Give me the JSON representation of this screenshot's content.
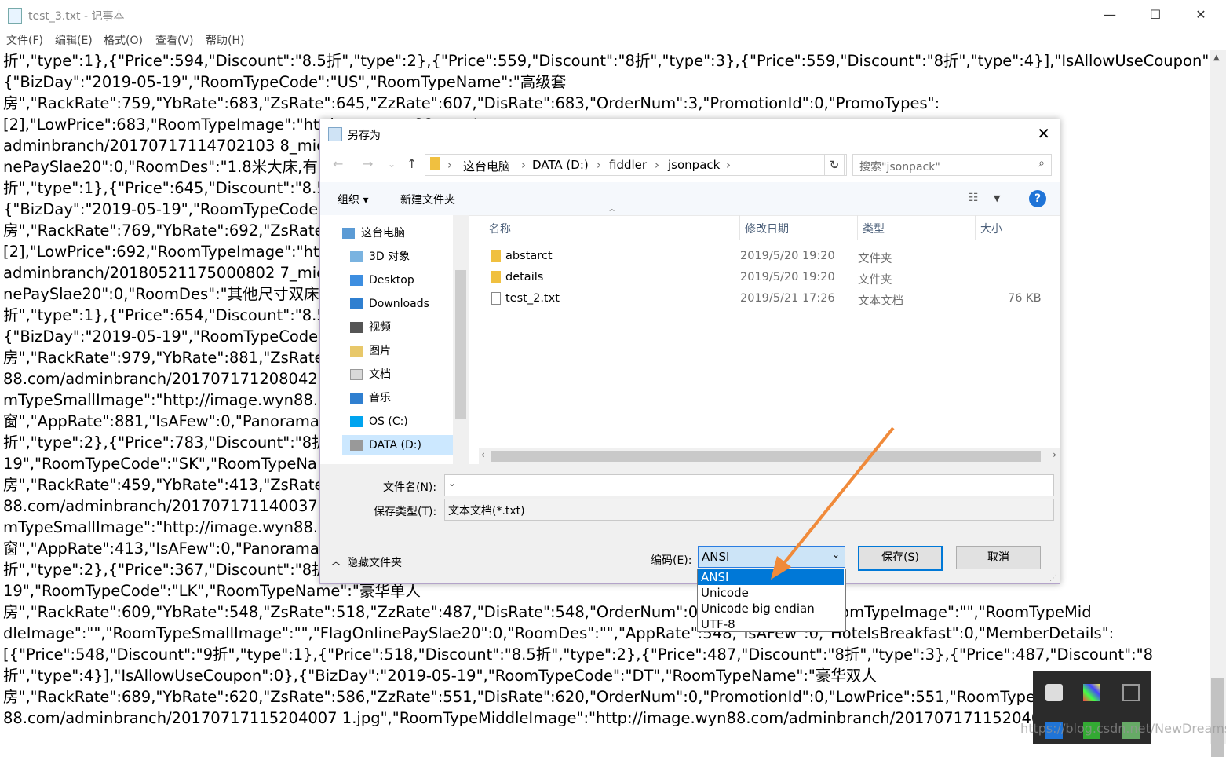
{
  "notepad": {
    "title": "test_3.txt - 记事本",
    "menu": [
      "文件(F)",
      "编辑(E)",
      "格式(O)",
      "查看(V)",
      "帮助(H)"
    ],
    "lines": [
      "折\",\"type\":1},{\"Price\":594,\"Discount\":\"8.5折\",\"type\":2},{\"Price\":559,\"Discount\":\"8折\",\"type\":3},{\"Price\":559,\"Discount\":\"8折\",\"type\":4}],\"IsAllowUseCoupon\":0},",
      "{\"BizDay\":\"2019-05-19\",\"RoomTypeCode\":\"US\",\"RoomTypeName\":\"高级套",
      "房\",\"RackRate\":759,\"YbRate\":683,\"ZsRate\":645,\"ZzRate\":607,\"DisRate\":683,\"OrderNum\":3,\"PromotionId\":0,\"PromoTypes\":",
      "[2],\"LowPrice\":683,\"RoomTypeImage\":\"htt                                                                                          image.wyn88.com/",
      "adminbranch/20170717114702103 8_midc                                                                                    mall.jpg\",\"FlagOnli",
      "nePaySlae20\":0,\"RoomDes\":\"1.8米大床,有窗                                                                              Discount\":\"9",
      "折\",\"type\":1},{\"Price\":645,\"Discount\":\"8.5折                                                                              eCoupon\":0},",
      "{\"BizDay\":\"2019-05-19\",\"RoomTypeCode\"",
      "房\",\"RackRate\":769,\"YbRate\":692,\"ZsRate\":",
      "[2],\"LowPrice\":692,\"RoomTypeImage\":\"htt                                                                                          image.wyn88.com/",
      "adminbranch/20180521175000802 7_midc                                                                                    mall.jpg\",\"FlagOnli",
      "nePaySlae20\":0,\"RoomDes\":\"其他尺寸双床,                                                                          92,\"Discount\":\"9",
      "折\",\"type\":1},{\"Price\":654,\"Discount\":\"8.5折                                                                              eCoupon\":0},",
      "{\"BizDay\":\"2019-05-19\",\"RoomTypeCode\"",
      "房\",\"RackRate\":979,\"YbRate\":881,\"ZsRate\":                                                                              \"http://image.wyn",
      "88.com/adminbranch/201707171208042                                                                                  middle.jpg\",\"Roo",
      "mTypeSmallImage\":\"http://image.wyn88.c                                                                               末,无",
      "窗\",\"AppRate\":881,\"IsAFew\":0,\"Panorama_                                                                             iscount\":\"8.5",
      "折\",\"type\":2},{\"Price\":783,\"Discount\":\"8折\",",
      "19\",\"RoomTypeCode\":\"SK\",\"RoomTypeNa",
      "房\",\"RackRate\":459,\"YbRate\":413,\"ZsRate\":                                                                              \"http://image.wyn",
      "88.com/adminbranch/201707171140037                                                                                  middle.jpg\",\"Roo",
      "mTypeSmallImage\":\"http://image.wyn88.c                                                                               末,无",
      "窗\",\"AppRate\":413,\"IsAFew\":0,\"Panorama_                                                                             iscount\":\"8.5",
      "折\",\"type\":2},{\"Price\":367,\"Discount\":\"8折\",",
      "19\",\"RoomTypeCode\":\"LK\",\"RoomTypeName\":\"豪华单人",
      "房\",\"RackRate\":609,\"YbRate\":548,\"ZsRate\":518,\"ZzRate\":487,\"DisRate\":548,\"OrderNum\":0,\"Pro                      rice\":487,\"RoomTypeImage\":\"\",\"RoomTypeMid",
      "dleImage\":\"\",\"RoomTypeSmallImage\":\"\",\"FlagOnlinePaySlae20\":0,\"RoomDes\":\"\",\"AppRate\":548,\"IsAFew\":0,\"HotelsBreakfast\":0,\"MemberDetails\":",
      "[{\"Price\":548,\"Discount\":\"9折\",\"type\":1},{\"Price\":518,\"Discount\":\"8.5折\",\"type\":2},{\"Price\":487,\"Discount\":\"8折\",\"type\":3},{\"Price\":487,\"Discount\":\"8",
      "折\",\"type\":4}],\"IsAllowUseCoupon\":0},{\"BizDay\":\"2019-05-19\",\"RoomTypeCode\":\"DT\",\"RoomTypeName\":\"豪华双人",
      "房\",\"RackRate\":689,\"YbRate\":620,\"ZsRate\":586,\"ZzRate\":551,\"DisRate\":620,\"OrderNum\":0,\"PromotionId\":0,\"LowPrice\":551,\"RoomTypeImag             ge.wyn",
      "88.com/adminbranch/20170717115204007 1.jpg\",\"RoomTypeMiddleImage\":\"http://image.wyn88.com/adminbranch/201707171152040                   \"Roo"
    ]
  },
  "dialog": {
    "title": "另存为",
    "breadcrumb": [
      "这台电脑",
      "DATA (D:)",
      "fiddler",
      "jsonpack"
    ],
    "search_placeholder": "搜索\"jsonpack\"",
    "organize": "组织 ▾",
    "new_folder": "新建文件夹",
    "nav_items": [
      "这台电脑",
      "3D 对象",
      "Desktop",
      "Downloads",
      "视频",
      "图片",
      "文档",
      "音乐",
      "OS (C:)",
      "DATA (D:)"
    ],
    "columns": [
      "名称",
      "修改日期",
      "类型",
      "大小"
    ],
    "files": [
      {
        "name": "abstarct",
        "date": "2019/5/20 19:20",
        "type": "文件夹",
        "size": ""
      },
      {
        "name": "details",
        "date": "2019/5/20 19:20",
        "type": "文件夹",
        "size": ""
      },
      {
        "name": "test_2.txt",
        "date": "2019/5/21 17:26",
        "type": "文本文档",
        "size": "76 KB"
      }
    ],
    "filename_label": "文件名(N):",
    "filename_value": "",
    "filetype_label": "保存类型(T):",
    "filetype_value": "文本文档(*.txt)",
    "hide_folders": "隐藏文件夹",
    "encoding_label": "编码(E):",
    "encoding_value": "ANSI",
    "encoding_options": [
      "ANSI",
      "Unicode",
      "Unicode big endian",
      "UTF-8"
    ],
    "save": "保存(S)",
    "cancel": "取消"
  },
  "watermark": "https://blog.csdn.net/NewDreamstyle",
  "colors": {
    "accent": "#0078d7",
    "arrow": "#f08a3a"
  }
}
